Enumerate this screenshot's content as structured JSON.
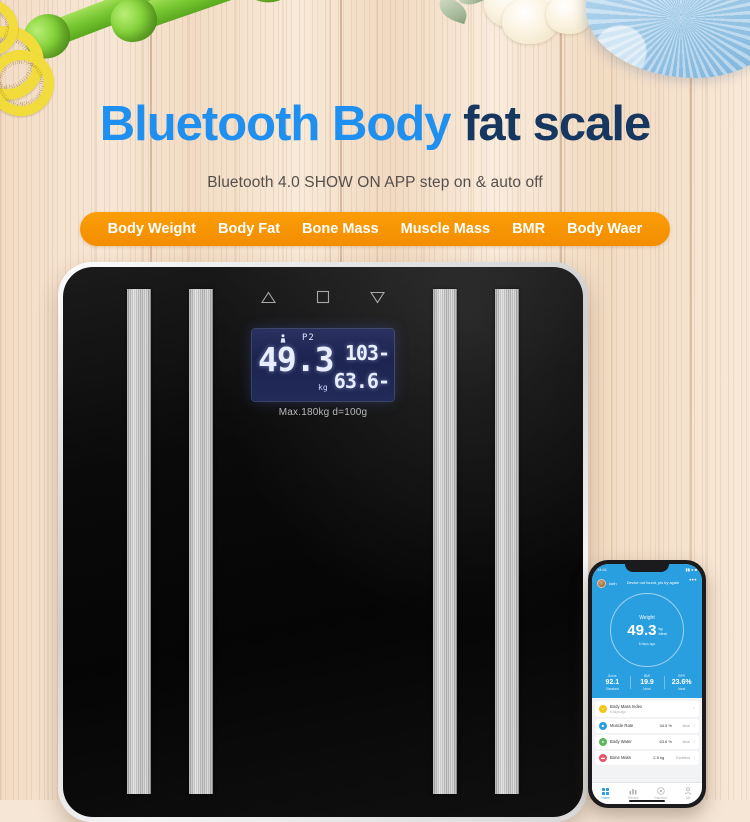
{
  "headline": {
    "part1": "Bluetooth Body",
    "part2": "fat scale"
  },
  "subtitle": "Bluetooth 4.0  SHOW ON APP  step on  & auto off",
  "features": [
    {
      "label": "Body Weight"
    },
    {
      "label": "Body Fat"
    },
    {
      "label": "Bone Mass"
    },
    {
      "label": "Muscle Mass"
    },
    {
      "label": "BMR"
    },
    {
      "label": "Body Waer"
    }
  ],
  "colors": {
    "headline_blue": "#1f8ff0",
    "headline_navy": "#16375f",
    "feature_orange": "#f38d00",
    "app_blue": "#2a9fe0"
  },
  "scale": {
    "indicators": [
      {
        "icon": "triangle-up-icon"
      },
      {
        "icon": "square-icon"
      },
      {
        "icon": "triangle-down-icon"
      }
    ],
    "lcd": {
      "user_icon": "person-icon",
      "profile": "P2",
      "weight": "49.3",
      "unit": "kg",
      "reading_top": "103-",
      "reading_bottom": "63.6-"
    },
    "capacity": "Max.180kg d=100g"
  },
  "phone": {
    "status": {
      "time": "14:41",
      "icons": "signal-wifi-battery-icons"
    },
    "header": {
      "avatar": "user-avatar",
      "user": "kuth",
      "message": "Device not found, pls try again",
      "menu": "more-options-icon"
    },
    "hero": {
      "label": "Weight",
      "value": "49.3",
      "unit": "kg",
      "rating": "Ideal",
      "timestamp": "6 days ago"
    },
    "stats": [
      {
        "key": "Score",
        "value": "92.1",
        "tag": "Standard"
      },
      {
        "key": "BMI",
        "value": "19.9",
        "tag": "Ideal"
      },
      {
        "key": "BFR",
        "value": "23.6%",
        "tag": "Ideal"
      }
    ],
    "list": [
      {
        "name": "Body Mass Index",
        "sub": "6 days ago",
        "value": "",
        "tag": "",
        "color": "#f5c518",
        "icon": "bmi-icon"
      },
      {
        "name": "Muscle Rate",
        "sub": "",
        "value": "34.5 %",
        "tag": "Ideal",
        "color": "#2a9fe0",
        "icon": "muscle-icon"
      },
      {
        "name": "Body Water",
        "sub": "",
        "value": "63.6 %",
        "tag": "Ideal",
        "color": "#5cb85c",
        "icon": "water-icon"
      },
      {
        "name": "Bone Mass",
        "sub": "",
        "value": "2.5 kg",
        "tag": "Excellent",
        "color": "#e8536a",
        "icon": "bone-icon"
      }
    ],
    "tabs": [
      {
        "label": "Home",
        "icon": "home-grid-icon"
      },
      {
        "label": "Record",
        "icon": "chart-bars-icon"
      },
      {
        "label": "Discover",
        "icon": "compass-icon"
      },
      {
        "label": "Me",
        "icon": "person-icon"
      }
    ]
  }
}
